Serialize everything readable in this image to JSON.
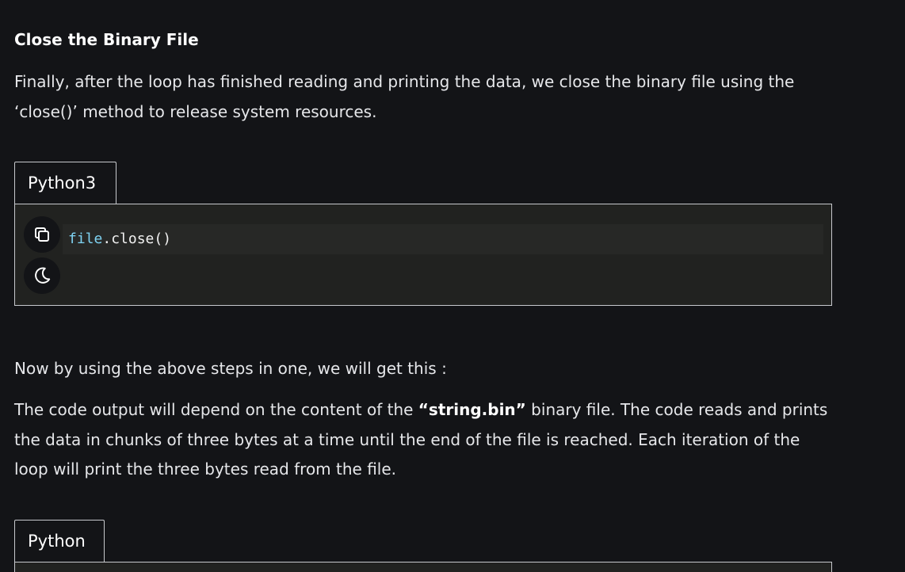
{
  "section": {
    "heading": "Close the Binary File",
    "intro": "Finally, after the loop has finished reading and printing the data, we close the binary file using the ‘close()’ method to release system resources."
  },
  "code_block_1": {
    "language_tab": "Python3",
    "code": {
      "object": "file",
      "dot": ".",
      "method": "close()"
    },
    "copy_icon": "copy-icon",
    "theme_icon": "moon-icon"
  },
  "summary": {
    "line1": "Now by using the above steps in one, we will get this :",
    "para_before": "The code output will depend on the content of the ",
    "para_bold": "“string.bin”",
    "para_after": " binary file. The code reads and prints the data in chunks of three bytes at a time until the end of the file is reached. Each iteration of the loop will print the three bytes read from the file."
  },
  "code_block_2": {
    "language_tab": "Python"
  }
}
